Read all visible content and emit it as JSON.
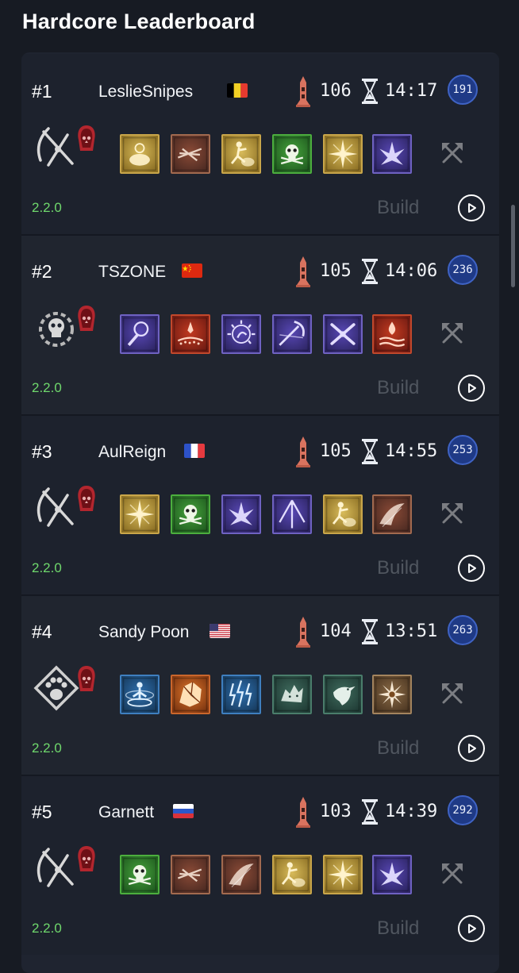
{
  "page": {
    "title": "Hardcore Leaderboard"
  },
  "labels": {
    "build": "Build"
  },
  "entries": [
    {
      "rank": "#1",
      "name": "LeslieSnipes",
      "flag": "be",
      "depth": "106",
      "time": "14:17",
      "level": "191",
      "version": "2.2.0",
      "class_icon": "necromancer-scythe-icon",
      "skills": [
        {
          "icon": "corpse-explosion-icon",
          "theme": "gold"
        },
        {
          "icon": "bone-splinters-icon",
          "theme": "rust"
        },
        {
          "icon": "golem-summon-icon",
          "theme": "gold"
        },
        {
          "icon": "skull-poison-icon",
          "theme": "green"
        },
        {
          "icon": "starburst-icon",
          "theme": "gold"
        },
        {
          "icon": "shadow-blast-icon",
          "theme": "purple"
        }
      ]
    },
    {
      "rank": "#2",
      "name": "TSZONE",
      "flag": "cn",
      "depth": "105",
      "time": "14:06",
      "level": "236",
      "version": "2.2.0",
      "class_icon": "necromancer-skull-gear-icon",
      "skills": [
        {
          "icon": "orb-strike-icon",
          "theme": "purple"
        },
        {
          "icon": "blood-drops-icon",
          "theme": "red"
        },
        {
          "icon": "spiked-arc-icon",
          "theme": "purple"
        },
        {
          "icon": "reap-slash-icon",
          "theme": "purple"
        },
        {
          "icon": "crossed-bones-icon",
          "theme": "purple"
        },
        {
          "icon": "blood-wave-icon",
          "theme": "red"
        }
      ]
    },
    {
      "rank": "#3",
      "name": "AulReign",
      "flag": "fr",
      "depth": "105",
      "time": "14:55",
      "level": "253",
      "version": "2.2.0",
      "class_icon": "necromancer-scythe-icon",
      "skills": [
        {
          "icon": "starburst-icon",
          "theme": "gold"
        },
        {
          "icon": "skull-poison-icon",
          "theme": "green"
        },
        {
          "icon": "shadow-blast-icon",
          "theme": "purple"
        },
        {
          "icon": "arrow-spread-icon",
          "theme": "purple"
        },
        {
          "icon": "golem-summon-icon",
          "theme": "gold"
        },
        {
          "icon": "blade-wave-icon",
          "theme": "rust"
        }
      ]
    },
    {
      "rank": "#4",
      "name": "Sandy Poon",
      "flag": "us",
      "depth": "104",
      "time": "13:51",
      "level": "263",
      "version": "2.2.0",
      "class_icon": "druid-paw-icon",
      "skills": [
        {
          "icon": "cyclone-figure-icon",
          "theme": "blue"
        },
        {
          "icon": "earth-burst-icon",
          "theme": "orange"
        },
        {
          "icon": "lightning-storm-icon",
          "theme": "blue"
        },
        {
          "icon": "wolf-pack-icon",
          "theme": "teal"
        },
        {
          "icon": "raven-icon",
          "theme": "teal"
        },
        {
          "icon": "thorn-bloom-icon",
          "theme": "tan"
        }
      ]
    },
    {
      "rank": "#5",
      "name": "Garnett",
      "flag": "ru",
      "depth": "103",
      "time": "14:39",
      "level": "292",
      "version": "2.2.0",
      "class_icon": "necromancer-scythe-icon",
      "skills": [
        {
          "icon": "skull-poison-icon",
          "theme": "green"
        },
        {
          "icon": "bone-splinters-icon",
          "theme": "rust"
        },
        {
          "icon": "blade-wave-icon",
          "theme": "rust"
        },
        {
          "icon": "golem-summon-icon",
          "theme": "gold"
        },
        {
          "icon": "starburst-icon",
          "theme": "gold"
        },
        {
          "icon": "shadow-blast-icon",
          "theme": "purple"
        }
      ]
    }
  ],
  "colors": {
    "accent_version": "#6fd86c",
    "level_badge": "#1f3a86",
    "hardcore_skull": "#c8323a",
    "build_text": "#50565f"
  }
}
